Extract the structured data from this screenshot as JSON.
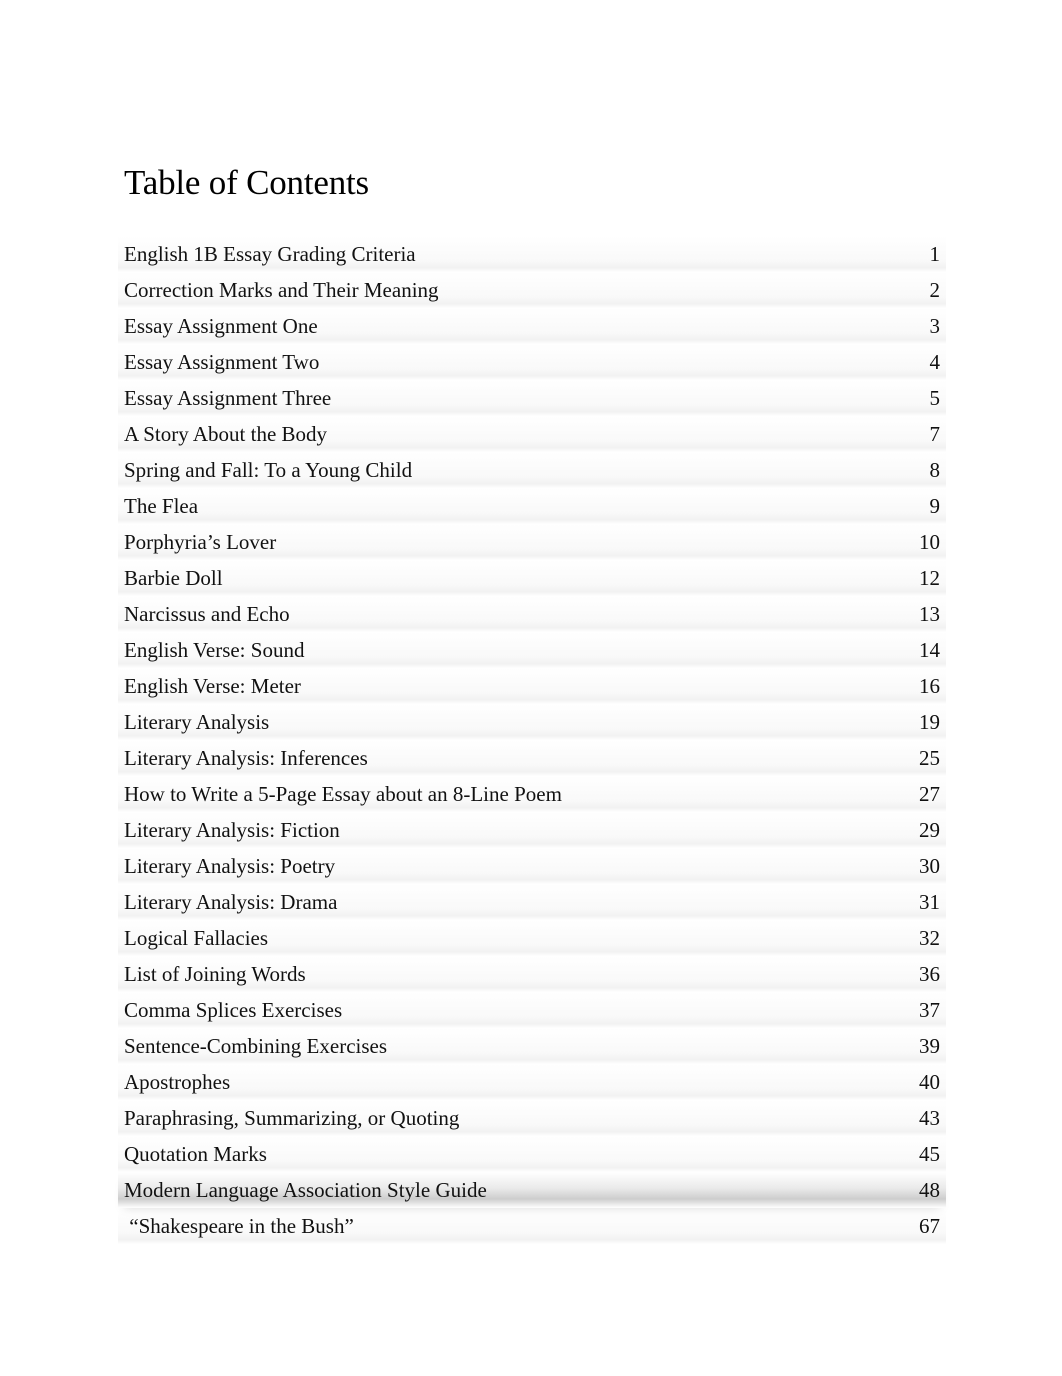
{
  "document": {
    "title": "Table of Contents"
  },
  "toc": {
    "entries": [
      {
        "label": "English 1B Essay Grading Criteria",
        "page": "1"
      },
      {
        "label": "Correction Marks and Their Meaning",
        "page": "2"
      },
      {
        "label": "Essay Assignment One",
        "page": "3"
      },
      {
        "label": "Essay Assignment Two",
        "page": "4"
      },
      {
        "label": "Essay Assignment Three",
        "page": "5"
      },
      {
        "label": "A Story About the Body",
        "page": "7"
      },
      {
        "label": "Spring and Fall: To a Young Child",
        "page": "8"
      },
      {
        "label": "The Flea",
        "page": "9"
      },
      {
        "label": "Porphyria’s Lover",
        "page": "10"
      },
      {
        "label": "Barbie Doll",
        "page": "12"
      },
      {
        "label": "Narcissus and Echo",
        "page": "13"
      },
      {
        "label": "English Verse: Sound",
        "page": "14"
      },
      {
        "label": "English Verse: Meter",
        "page": "16"
      },
      {
        "label": "Literary Analysis",
        "page": "19"
      },
      {
        "label": "Literary Analysis: Inferences",
        "page": "25"
      },
      {
        "label": "How to Write a 5-Page Essay about an 8-Line Poem",
        "page": "27"
      },
      {
        "label": "Literary Analysis: Fiction",
        "page": "29"
      },
      {
        "label": "Literary Analysis: Poetry",
        "page": "30"
      },
      {
        "label": "Literary Analysis: Drama",
        "page": "31"
      },
      {
        "label": "Logical Fallacies",
        "page": "32"
      },
      {
        "label": "List of Joining Words",
        "page": "36"
      },
      {
        "label": "Comma Splices Exercises",
        "page": "37"
      },
      {
        "label": "Sentence-Combining Exercises",
        "page": "39"
      },
      {
        "label": "Apostrophes",
        "page": "40"
      },
      {
        "label": "Paraphrasing, Summarizing, or Quoting",
        "page": "43"
      },
      {
        "label": "Quotation Marks",
        "page": "45"
      },
      {
        "label": "Modern Language Association Style Guide",
        "page": "48",
        "highlighted": true
      },
      {
        "label": " “Shakespeare in the Bush”",
        "page": "67"
      }
    ]
  }
}
